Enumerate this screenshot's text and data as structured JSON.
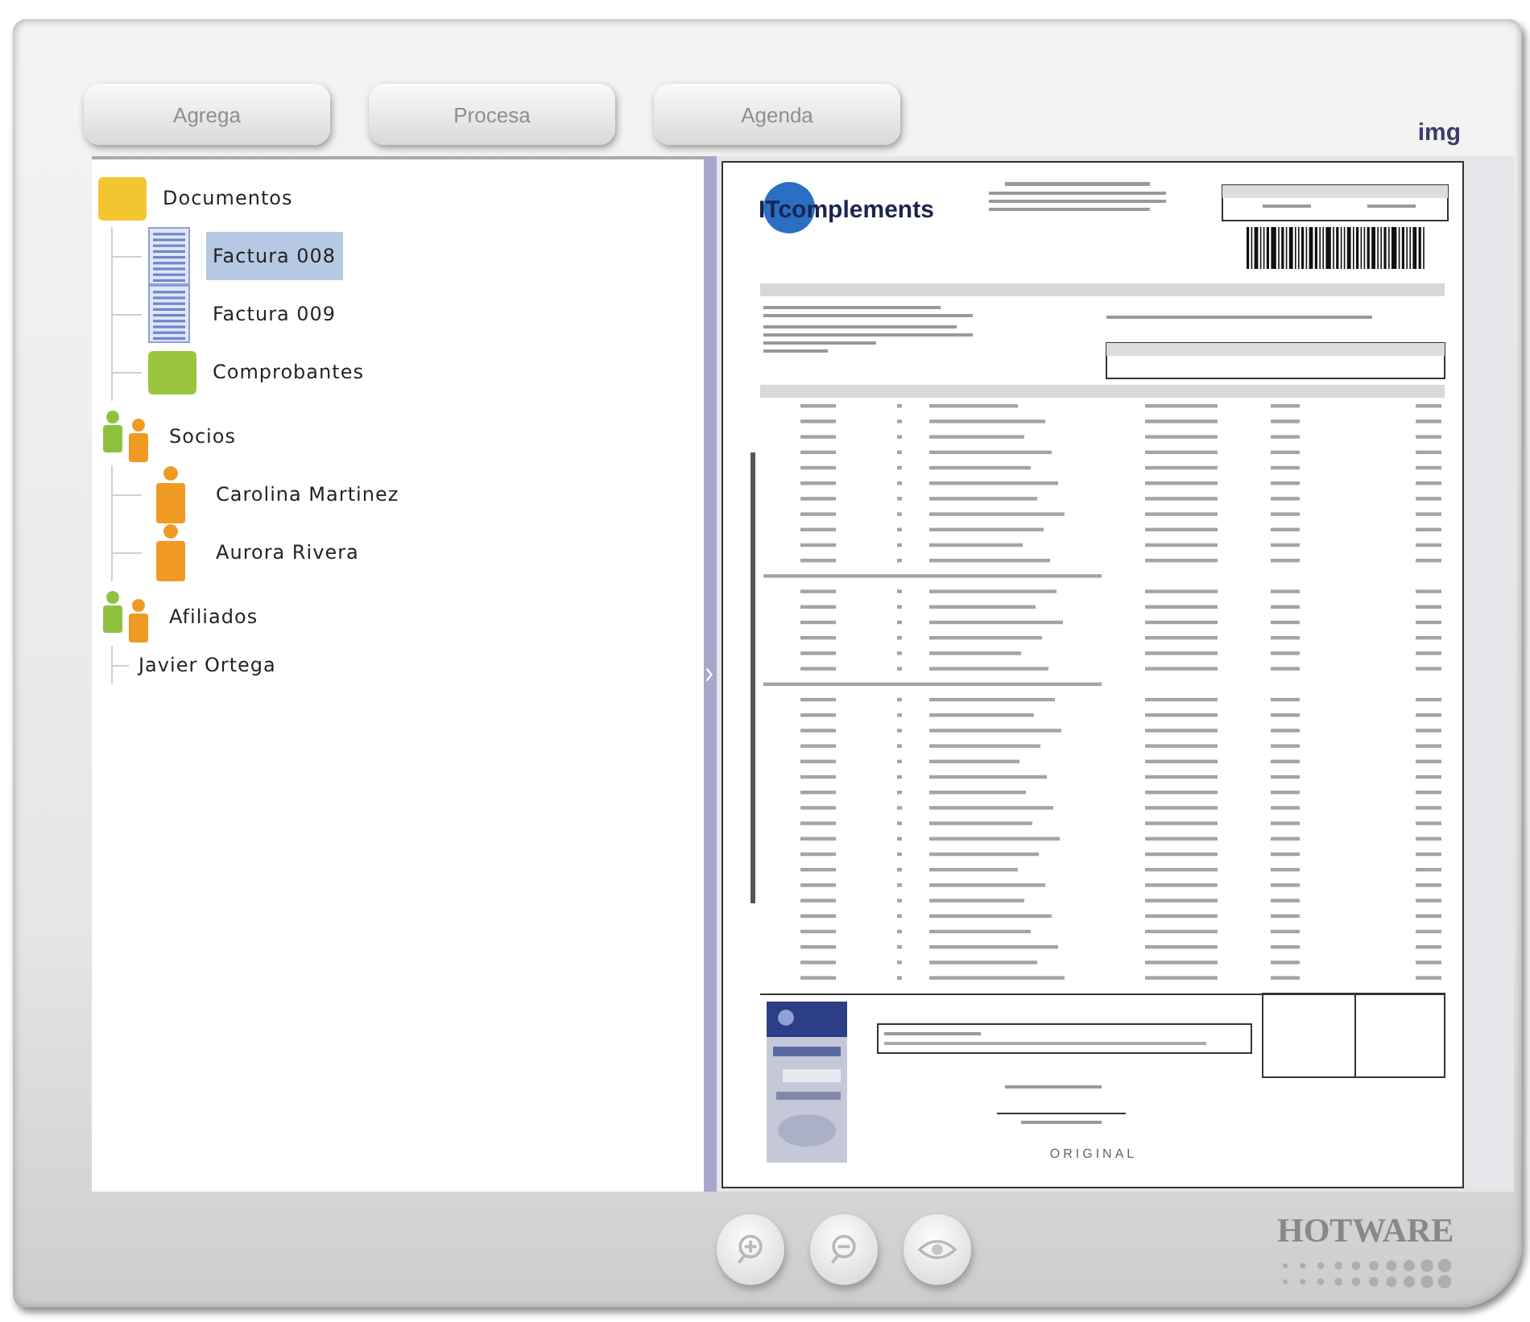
{
  "toolbar": {
    "buttons": [
      {
        "label": "Agrega",
        "disabled": true
      },
      {
        "label": "Procesa",
        "disabled": true
      },
      {
        "label": "Agenda",
        "disabled": true
      }
    ],
    "image_label": "img"
  },
  "tree": [
    {
      "label": "Documentos",
      "kind": "folder",
      "color": "#f2c531",
      "selected": false,
      "children": [
        {
          "label": "Factura 008",
          "kind": "document",
          "selected": true
        },
        {
          "label": "Factura 009",
          "kind": "document",
          "selected": false
        },
        {
          "label": "Comprobantes",
          "kind": "folder",
          "color": "#9bc53d",
          "selected": false
        }
      ]
    },
    {
      "label": "Socios",
      "kind": "group",
      "selected": false,
      "children": [
        {
          "label": "Carolina Martinez",
          "kind": "person",
          "selected": false
        },
        {
          "label": "Aurora Rivera",
          "kind": "person",
          "selected": false
        }
      ]
    },
    {
      "label": "Afiliados",
      "kind": "group",
      "selected": false,
      "children": [
        {
          "label": "Javier Ortega",
          "kind": "plain",
          "selected": false
        }
      ]
    }
  ],
  "document": {
    "logo": "ITcomplements",
    "stamp": "ORIGINAL"
  },
  "brand": "HOTWARE"
}
